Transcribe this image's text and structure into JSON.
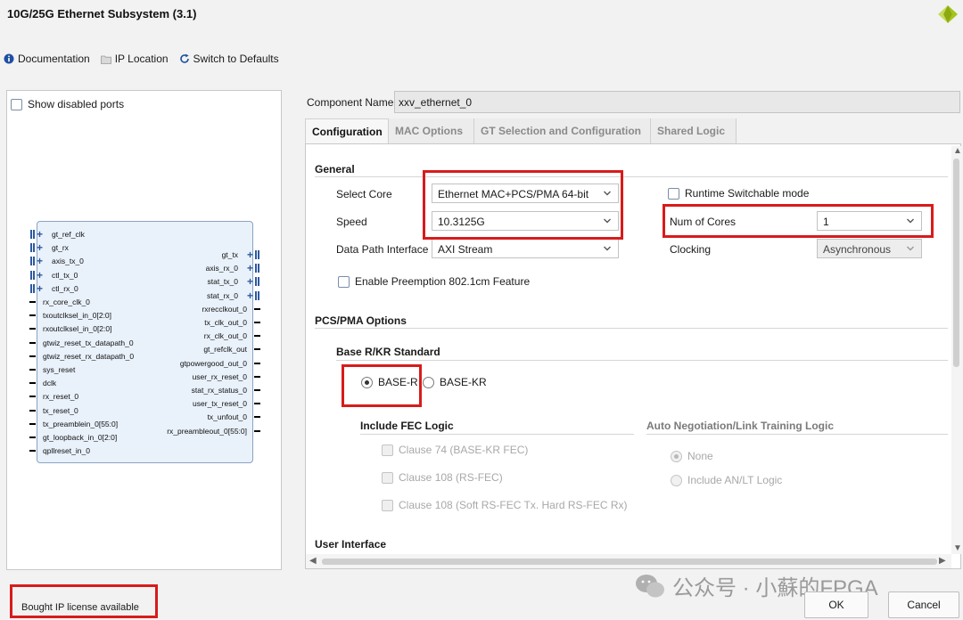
{
  "window": {
    "title": "10G/25G Ethernet Subsystem (3.1)"
  },
  "toolbar": {
    "documentation": "Documentation",
    "ip_location": "IP Location",
    "switch_defaults": "Switch to Defaults"
  },
  "left_pane": {
    "show_disabled_ports": "Show disabled ports",
    "block": {
      "left_bus_ports": [
        "gt_ref_clk",
        "gt_rx",
        "axis_tx_0",
        "ctl_tx_0",
        "ctl_rx_0"
      ],
      "left_ports": [
        "rx_core_clk_0",
        "txoutclksel_in_0[2:0]",
        "rxoutclksel_in_0[2:0]",
        "gtwiz_reset_tx_datapath_0",
        "gtwiz_reset_rx_datapath_0",
        "sys_reset",
        "dclk",
        "rx_reset_0",
        "tx_reset_0",
        "tx_preamblein_0[55:0]",
        "gt_loopback_in_0[2:0]",
        "qpllreset_in_0"
      ],
      "right_bus_ports": [
        "gt_tx",
        "axis_rx_0",
        "stat_tx_0",
        "stat_rx_0"
      ],
      "right_ports": [
        "rxrecclkout_0",
        "tx_clk_out_0",
        "rx_clk_out_0",
        "gt_refclk_out",
        "gtpowergood_out_0",
        "user_rx_reset_0",
        "stat_rx_status_0",
        "user_tx_reset_0",
        "tx_unfout_0",
        "rx_preambleout_0[55:0]"
      ]
    }
  },
  "component": {
    "label": "Component Name",
    "value": "xxv_ethernet_0"
  },
  "tabs": [
    "Configuration",
    "MAC Options",
    "GT Selection and Configuration",
    "Shared Logic"
  ],
  "general": {
    "title": "General",
    "select_core_label": "Select Core",
    "select_core_value": "Ethernet MAC+PCS/PMA 64-bit",
    "speed_label": "Speed",
    "speed_value": "10.3125G",
    "data_path_label": "Data Path Interface",
    "data_path_value": "AXI Stream",
    "runtime_switchable": "Runtime Switchable mode",
    "num_cores_label": "Num of Cores",
    "num_cores_value": "1",
    "clocking_label": "Clocking",
    "clocking_value": "Asynchronous",
    "preemption": "Enable Preemption 802.1cm Feature"
  },
  "pcs_pma": {
    "title": "PCS/PMA Options",
    "base_standard_title": "Base R/KR Standard",
    "base_r": "BASE-R",
    "base_kr": "BASE-KR",
    "fec_title": "Include FEC Logic",
    "fec_options": [
      "Clause 74 (BASE-KR FEC)",
      "Clause 108 (RS-FEC)",
      "Clause 108 (Soft RS-FEC Tx. Hard RS-FEC Rx)"
    ],
    "an_title": "Auto Negotiation/Link Training Logic",
    "an_none": "None",
    "an_include": "Include AN/LT Logic"
  },
  "user_interface": {
    "title": "User Interface"
  },
  "footer": {
    "license": "Bought IP license available",
    "ok": "OK",
    "cancel": "Cancel"
  },
  "watermark": {
    "text": "公众号 · 小蘇的FPGA"
  },
  "colors": {
    "highlight_box": "#d81b1b",
    "accent_blue": "#2c5aa0",
    "logo_green": "#a4c418"
  }
}
